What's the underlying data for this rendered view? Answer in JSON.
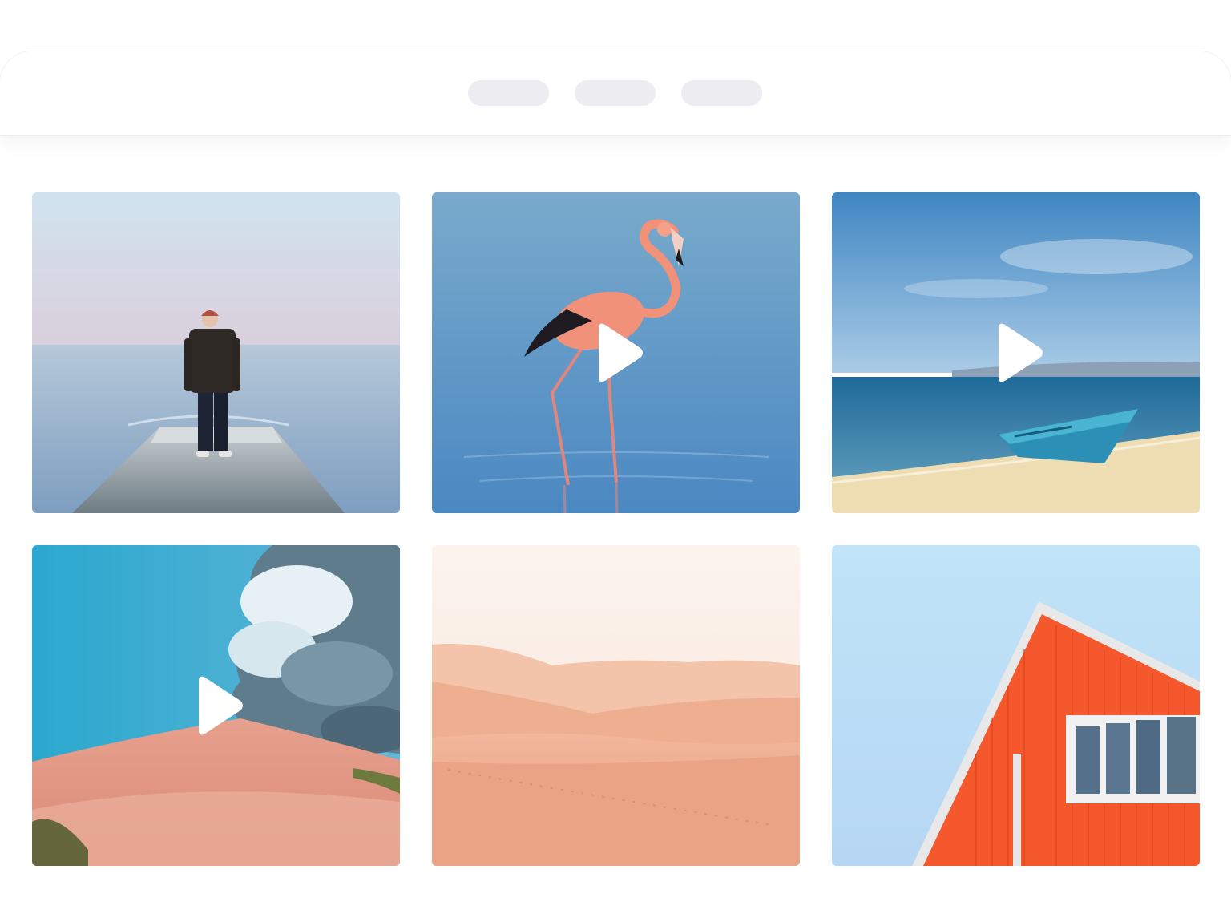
{
  "header": {
    "tabs": [
      {
        "label": ""
      },
      {
        "label": ""
      },
      {
        "label": ""
      }
    ],
    "tab_color": "#ececf1"
  },
  "gallery": {
    "items": [
      {
        "icon": "photo-icon",
        "subject": "person-on-pier",
        "is_video": false
      },
      {
        "icon": "play-icon",
        "subject": "flamingo",
        "is_video": true
      },
      {
        "icon": "play-icon",
        "subject": "boat-on-beach",
        "is_video": true
      },
      {
        "icon": "play-icon",
        "subject": "desert-dune-clouds",
        "is_video": true
      },
      {
        "icon": "photo-icon",
        "subject": "desert-dunes",
        "is_video": false
      },
      {
        "icon": "photo-icon",
        "subject": "orange-house",
        "is_video": false
      }
    ]
  },
  "colors": {
    "background": "#ffffff",
    "play_button": "#ffffff",
    "sea_blue": "#8fb3cf",
    "flamingo_pink": "#f2917a",
    "sand": "#eeddb2",
    "dune": "#e69a80",
    "house_orange": "#f5582c",
    "sky_light": "#bfe0f7"
  }
}
